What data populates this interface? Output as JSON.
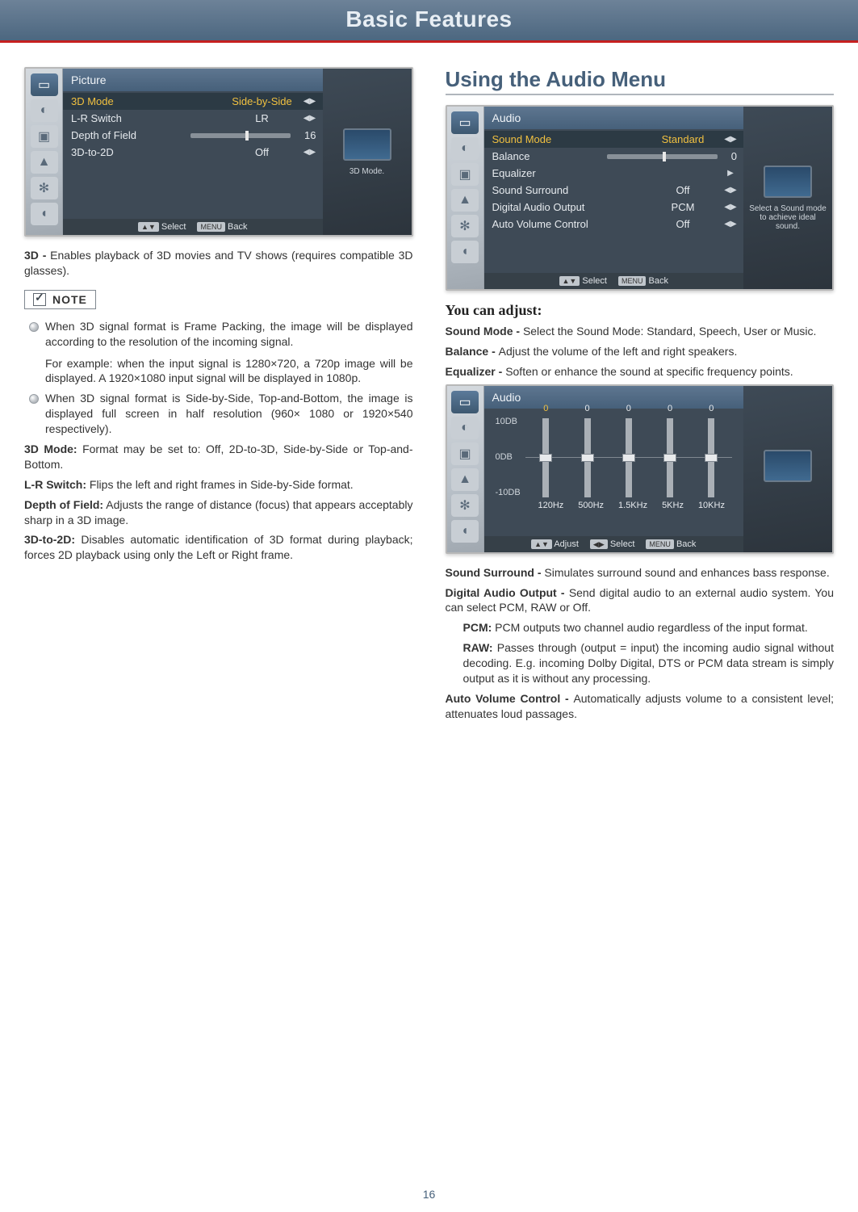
{
  "header": {
    "title": "Basic Features"
  },
  "page_number": "16",
  "left": {
    "osd_picture": {
      "title": "Picture",
      "hint": "3D Mode.",
      "rows": [
        {
          "label": "3D Mode",
          "value": "Side-by-Side",
          "highlight": true,
          "arrow": true
        },
        {
          "label": "L-R Switch",
          "value": "LR",
          "arrow": true
        },
        {
          "label": "Depth of Field",
          "value": "16",
          "slider": true,
          "slider_pos": 55
        },
        {
          "label": "3D-to-2D",
          "value": "Off",
          "arrow": true
        }
      ],
      "footer": {
        "select": "Select",
        "back": "Back",
        "menu_key": "MENU"
      }
    },
    "intro_3d": {
      "bold": "3D - ",
      "text": "Enables playback of 3D movies and TV shows (requires compatible 3D glasses)."
    },
    "note_label": "NOTE",
    "notes": [
      {
        "p1": "When 3D signal format is Frame Packing, the image will be displayed according to the resolution of the incoming signal.",
        "p2": "For example: when the input signal is 1280×720, a 720p image will be displayed. A 1920×1080 input signal will be displayed in 1080p."
      },
      {
        "p1": "When 3D signal format is Side-by-Side, Top-and-Bottom, the image is displayed full screen in half resolution (960× 1080 or 1920×540 respectively)."
      }
    ],
    "defs": [
      {
        "term": "3D Mode:",
        "text": " Format may be set to: Off, 2D-to-3D, Side-by-Side or Top-and-Bottom."
      },
      {
        "term": "L-R Switch:",
        "text": " Flips the left and right frames in Side-by-Side format."
      },
      {
        "term": "Depth of Field:",
        "text": " Adjusts the range of distance (focus) that appears acceptably sharp in a 3D image."
      },
      {
        "term": "3D-to-2D:",
        "text": " Disables automatic identification of 3D format during playback; forces 2D playback using only the Left or Right frame."
      }
    ]
  },
  "right": {
    "section_title": "Using the Audio Menu",
    "osd_audio": {
      "title": "Audio",
      "hint": "Select a Sound mode to achieve ideal sound.",
      "rows": [
        {
          "label": "Sound Mode",
          "value": "Standard",
          "highlight": true,
          "arrow": true,
          "yellow": true
        },
        {
          "label": "Balance",
          "value": "0",
          "slider": true,
          "slider_pos": 50
        },
        {
          "label": "Equalizer",
          "value": "",
          "chevron": true
        },
        {
          "label": "Sound Surround",
          "value": "Off",
          "arrow": true
        },
        {
          "label": "Digital Audio Output",
          "value": "PCM",
          "arrow": true
        },
        {
          "label": "Auto Volume Control",
          "value": "Off",
          "arrow": true
        }
      ],
      "footer": {
        "select": "Select",
        "back": "Back",
        "menu_key": "MENU"
      }
    },
    "adjust_heading": "You can adjust:",
    "sound_mode": {
      "term": "Sound Mode - ",
      "text": "Select the Sound Mode: Standard, Speech, User or Music."
    },
    "balance": {
      "term": "Balance - ",
      "text": "Adjust the volume of the left and right speakers."
    },
    "equalizer": {
      "term": "Equalizer - ",
      "text": "Soften or enhance the sound at specific frequency points."
    },
    "osd_eq": {
      "title": "Audio",
      "y_labels": [
        "10DB",
        "0DB",
        "-10DB"
      ],
      "bands": [
        {
          "freq": "120Hz",
          "db": "0",
          "hi": true
        },
        {
          "freq": "500Hz",
          "db": "0"
        },
        {
          "freq": "1.5KHz",
          "db": "0"
        },
        {
          "freq": "5KHz",
          "db": "0"
        },
        {
          "freq": "10KHz",
          "db": "0"
        }
      ],
      "footer": {
        "adjust": "Adjust",
        "select": "Select",
        "back": "Back",
        "menu_key": "MENU"
      }
    },
    "sound_surround": {
      "term": "Sound Surround - ",
      "text": "Simulates surround sound and enhances bass response."
    },
    "dao": {
      "term": "Digital Audio Output - ",
      "text": "Send digital audio to an external audio system. You can select PCM, RAW or Off.",
      "pcm": {
        "term": "PCM:",
        "text": " PCM outputs two channel audio regardless of the input format."
      },
      "raw": {
        "term": "RAW:",
        "text": " Passes through (output = input) the incoming audio signal without decoding. E.g. incoming Dolby Digital, DTS or PCM data stream is simply output as it is without any processing."
      }
    },
    "avc": {
      "term": "Auto Volume Control - ",
      "text": "Automatically adjusts volume to a consistent level; attenuates loud passages."
    }
  },
  "chart_data": {
    "type": "bar",
    "title": "Audio Equalizer",
    "ylabel": "dB",
    "ylim": [
      -10,
      10
    ],
    "categories": [
      "120Hz",
      "500Hz",
      "1.5KHz",
      "5KHz",
      "10KHz"
    ],
    "values": [
      0,
      0,
      0,
      0,
      0
    ]
  }
}
